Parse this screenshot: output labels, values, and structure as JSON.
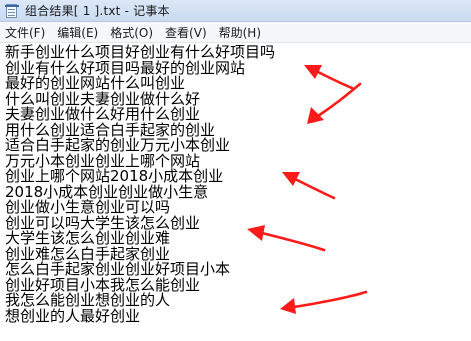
{
  "window": {
    "title": "组合结果[ 1 ].txt - 记事本"
  },
  "icons": {
    "app": "notepad-icon"
  },
  "menu": {
    "items": [
      {
        "label": "文件(F)"
      },
      {
        "label": "编辑(E)"
      },
      {
        "label": "格式(O)"
      },
      {
        "label": "查看(V)"
      },
      {
        "label": "帮助(H)"
      }
    ]
  },
  "document": {
    "lines": [
      "新手创业什么项目好创业有什么好项目吗",
      "创业有什么好项目吗最好的创业网站",
      "最好的创业网站什么叫创业",
      "什么叫创业夫妻创业做什么好",
      "夫妻创业做什么好用什么创业",
      "用什么创业适合白手起家的创业",
      "适合白手起家的创业万元小本创业",
      "万元小本创业创业上哪个网站",
      "创业上哪个网站2018小成本创业",
      "2018小成本创业创业做小生意",
      "创业做小生意创业可以吗",
      "创业可以吗大学生该怎么创业",
      "大学生该怎么创业创业难",
      "创业难怎么白手起家创业",
      "怎么白手起家创业创业好项目小本",
      "创业好项目小本我怎么能创业",
      "我怎么能创业想创业的人",
      "想创业的人最好创业"
    ]
  },
  "annotations": {
    "arrow_color": "#ff1a1a"
  }
}
